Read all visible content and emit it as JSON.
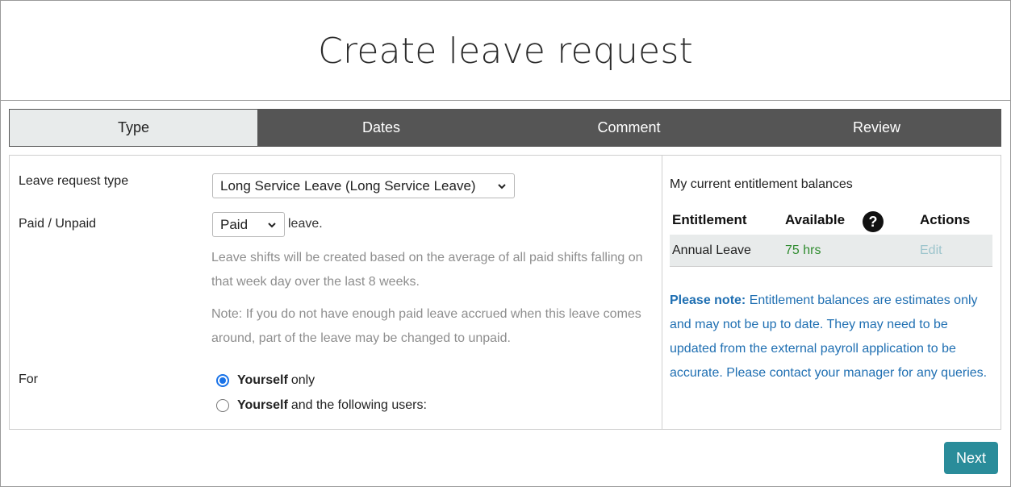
{
  "page": {
    "title": "Create leave request"
  },
  "tabs": [
    {
      "label": "Type",
      "active": true
    },
    {
      "label": "Dates",
      "active": false
    },
    {
      "label": "Comment",
      "active": false
    },
    {
      "label": "Review",
      "active": false
    }
  ],
  "form": {
    "leave_type_label": "Leave request type",
    "leave_type_value": "Long Service Leave (Long Service Leave)",
    "paid_label": "Paid / Unpaid",
    "paid_value": "Paid",
    "paid_suffix": "leave.",
    "help_text_1": "Leave shifts will be created based on the average of all paid shifts falling on that week day over the last 8 weeks.",
    "help_text_2": "Note: If you do not have enough paid leave accrued when this leave comes around, part of the leave may be changed to unpaid.",
    "for_label": "For",
    "for_options": [
      {
        "bold": "Yourself",
        "rest": "only",
        "checked": true
      },
      {
        "bold": "Yourself",
        "rest": "and the following users:",
        "checked": false
      }
    ]
  },
  "entitlements": {
    "title": "My current entitlement balances",
    "headers": {
      "entitlement": "Entitlement",
      "available": "Available",
      "actions": "Actions"
    },
    "help_icon": "question-circle-icon",
    "rows": [
      {
        "name": "Annual Leave",
        "available": "75 hrs",
        "action": "Edit"
      }
    ],
    "note_bold": "Please note:",
    "note_text": "Entitlement balances are estimates only and may not be up to date. They may need to be updated from the external payroll application to be accurate. Please contact your manager for any queries."
  },
  "footer": {
    "next_label": "Next"
  },
  "colors": {
    "tab_bar": "#555555",
    "tab_active": "#e8ebeb",
    "available_green": "#2e8b2e",
    "edit_muted": "#9cc4cc",
    "note_blue": "#1f6fb2",
    "next_button": "#2a8c9a"
  }
}
